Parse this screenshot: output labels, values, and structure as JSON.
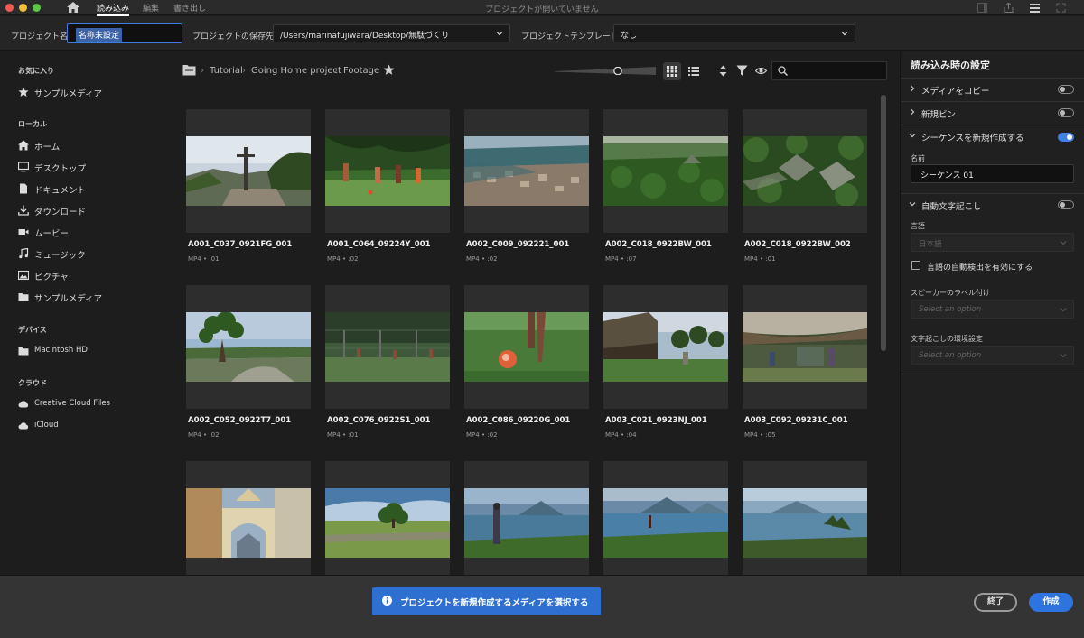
{
  "window": {
    "title": "プロジェクトが開いていません",
    "nav": {
      "import": "読み込み",
      "edit": "編集",
      "export": "書き出し"
    }
  },
  "projectbar": {
    "name_label": "プロジェクト名",
    "name_value": "名称未設定",
    "location_label": "プロジェクトの保存先",
    "location_value": "/Users/marinafujiwara/Desktop/無駄づくり",
    "template_label": "プロジェクトテンプレート",
    "template_value": "なし"
  },
  "sidebar": {
    "favorites_label": "お気に入り",
    "favorites": [
      {
        "label": "サンプルメディア",
        "icon": "star-icon"
      }
    ],
    "local_label": "ローカル",
    "local": [
      {
        "label": "ホーム",
        "icon": "home-icon"
      },
      {
        "label": "デスクトップ",
        "icon": "desktop-icon"
      },
      {
        "label": "ドキュメント",
        "icon": "document-icon"
      },
      {
        "label": "ダウンロード",
        "icon": "download-icon"
      },
      {
        "label": "ムービー",
        "icon": "movie-icon"
      },
      {
        "label": "ミュージック",
        "icon": "music-icon"
      },
      {
        "label": "ピクチャ",
        "icon": "picture-icon"
      },
      {
        "label": "サンプルメディア",
        "icon": "folder-icon"
      }
    ],
    "devices_label": "デバイス",
    "devices": [
      {
        "label": "Macintosh HD",
        "icon": "folder-icon"
      }
    ],
    "cloud_label": "クラウド",
    "cloud": [
      {
        "label": "Creative Cloud Files",
        "icon": "cloud-icon"
      },
      {
        "label": "iCloud",
        "icon": "cloud-icon"
      }
    ]
  },
  "breadcrumb": [
    "Tutorial",
    "Going Home project",
    "Footage"
  ],
  "search": {
    "placeholder": ""
  },
  "media": [
    {
      "name": "A001_C037_0921FG_001",
      "meta": "MP4 • :01",
      "scene": "cross"
    },
    {
      "name": "A001_C064_09224Y_001",
      "meta": "MP4 • :02",
      "scene": "soccer"
    },
    {
      "name": "A002_C009_092221_001",
      "meta": "MP4 • :02",
      "scene": "town"
    },
    {
      "name": "A002_C018_0922BW_001",
      "meta": "MP4 • :07",
      "scene": "jungle"
    },
    {
      "name": "A002_C018_0922BW_002",
      "meta": "MP4 • :01",
      "scene": "ruins"
    },
    {
      "name": "A002_C052_0922T7_001",
      "meta": "MP4 • :02",
      "scene": "tree"
    },
    {
      "name": "A002_C076_0922S1_001",
      "meta": "MP4 • :01",
      "scene": "fence"
    },
    {
      "name": "A002_C086_09220G_001",
      "meta": "MP4 • :02",
      "scene": "ball"
    },
    {
      "name": "A003_C021_0923NJ_001",
      "meta": "MP4 • :04",
      "scene": "hut"
    },
    {
      "name": "A003_C092_09231C_001",
      "meta": "MP4 • :05",
      "scene": "house"
    },
    {
      "name": "",
      "meta": "",
      "scene": "arch"
    },
    {
      "name": "",
      "meta": "",
      "scene": "field"
    },
    {
      "name": "",
      "meta": "",
      "scene": "lake1"
    },
    {
      "name": "",
      "meta": "",
      "scene": "lake2"
    },
    {
      "name": "",
      "meta": "",
      "scene": "lake3"
    }
  ],
  "import_settings": {
    "title": "読み込み時の設定",
    "copy_media": "メディアをコピー",
    "copy_media_on": false,
    "new_bin": "新規ビン",
    "new_bin_on": false,
    "new_sequence": "シーケンスを新規作成する",
    "new_sequence_on": true,
    "name_label": "名前",
    "sequence_name": "シーケンス 01",
    "auto_transcribe": "自動文字起こし",
    "auto_transcribe_on": false,
    "language_label": "言語",
    "language_value": "日本語",
    "auto_detect": "言語の自動検出を有効にする",
    "speaker_label": "スピーカーのラベル付け",
    "speaker_placeholder": "Select an option",
    "prefs_label": "文字起こしの環境設定",
    "prefs_placeholder": "Select an option"
  },
  "footer": {
    "message": "プロジェクトを新規作成するメディアを選択する",
    "exit": "終了",
    "create": "作成"
  },
  "colors": {
    "accent": "#2e74de",
    "background": "#1d1d1d"
  }
}
